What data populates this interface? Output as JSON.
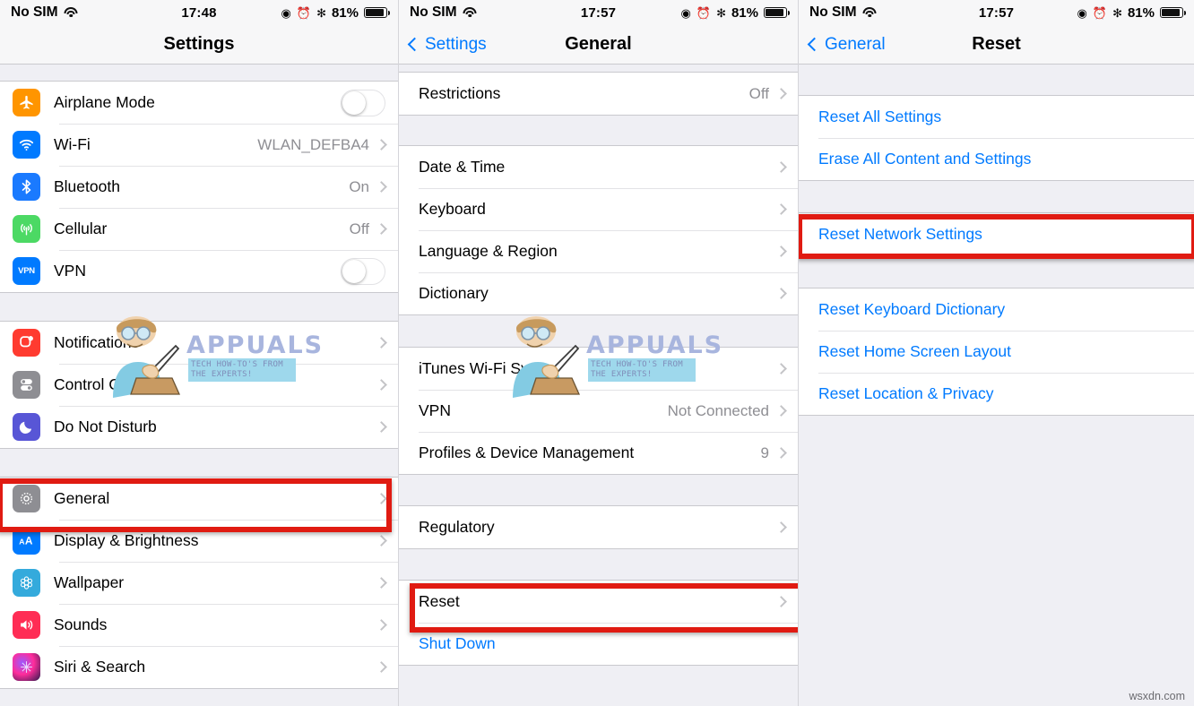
{
  "panels": [
    {
      "status": {
        "carrier": "No SIM",
        "time": "17:48",
        "battery_pct": "81%"
      },
      "nav": {
        "title": "Settings",
        "back": ""
      },
      "groups": [
        {
          "rows": [
            {
              "icon": "airplane-icon",
              "label": "Airplane Mode",
              "accessory": "toggle"
            },
            {
              "icon": "wifi-icon",
              "label": "Wi-Fi",
              "value": "WLAN_DEFBA4",
              "accessory": "chevron"
            },
            {
              "icon": "bluetooth-icon",
              "label": "Bluetooth",
              "value": "On",
              "accessory": "chevron"
            },
            {
              "icon": "cellular-icon",
              "label": "Cellular",
              "value": "Off",
              "accessory": "chevron"
            },
            {
              "icon": "vpn-icon",
              "label": "VPN",
              "accessory": "toggle"
            }
          ]
        },
        {
          "rows": [
            {
              "icon": "notifications-icon",
              "label": "Notifications",
              "accessory": "chevron"
            },
            {
              "icon": "control-center-icon",
              "label": "Control Center",
              "accessory": "chevron"
            },
            {
              "icon": "do-not-disturb-icon",
              "label": "Do Not Disturb",
              "accessory": "chevron"
            }
          ]
        },
        {
          "rows": [
            {
              "icon": "general-gear-icon",
              "label": "General",
              "accessory": "chevron",
              "highlighted": true
            },
            {
              "icon": "display-brightness-icon",
              "label": "Display & Brightness",
              "accessory": "chevron"
            },
            {
              "icon": "wallpaper-icon",
              "label": "Wallpaper",
              "accessory": "chevron"
            },
            {
              "icon": "sounds-icon",
              "label": "Sounds",
              "accessory": "chevron"
            },
            {
              "icon": "siri-search-icon",
              "label": "Siri & Search",
              "accessory": "chevron"
            }
          ]
        }
      ]
    },
    {
      "status": {
        "carrier": "No SIM",
        "time": "17:57",
        "battery_pct": "81%"
      },
      "nav": {
        "title": "General",
        "back": "Settings"
      },
      "groups": [
        {
          "rows": [
            {
              "label": "Restrictions",
              "value": "Off",
              "accessory": "chevron"
            }
          ]
        },
        {
          "rows": [
            {
              "label": "Date & Time",
              "accessory": "chevron"
            },
            {
              "label": "Keyboard",
              "accessory": "chevron"
            },
            {
              "label": "Language & Region",
              "accessory": "chevron"
            },
            {
              "label": "Dictionary",
              "accessory": "chevron"
            }
          ]
        },
        {
          "rows": [
            {
              "label": "iTunes Wi-Fi Sync",
              "accessory": "chevron"
            },
            {
              "label": "VPN",
              "value": "Not Connected",
              "accessory": "chevron"
            },
            {
              "label": "Profiles & Device Management",
              "value": "9",
              "accessory": "chevron"
            }
          ]
        },
        {
          "rows": [
            {
              "label": "Regulatory",
              "accessory": "chevron"
            }
          ]
        },
        {
          "rows": [
            {
              "label": "Reset",
              "accessory": "chevron",
              "highlighted": true
            },
            {
              "label": "Shut Down",
              "blue": true
            }
          ]
        }
      ]
    },
    {
      "status": {
        "carrier": "No SIM",
        "time": "17:57",
        "battery_pct": "81%"
      },
      "nav": {
        "title": "Reset",
        "back": "General"
      },
      "groups": [
        {
          "rows": [
            {
              "label": "Reset All Settings",
              "blue": true
            },
            {
              "label": "Erase All Content and Settings",
              "blue": true
            }
          ]
        },
        {
          "rows": [
            {
              "label": "Reset Network Settings",
              "blue": true,
              "highlighted": true
            }
          ]
        },
        {
          "rows": [
            {
              "label": "Reset Keyboard Dictionary",
              "blue": true
            },
            {
              "label": "Reset Home Screen Layout",
              "blue": true
            },
            {
              "label": "Reset Location & Privacy",
              "blue": true
            }
          ]
        }
      ]
    }
  ],
  "watermark": {
    "brand": "APPUALS",
    "tagline_1": "TECH HOW-TO'S FROM",
    "tagline_2": "THE EXPERTS!"
  },
  "footer_watermark": "wsxdn.com",
  "colors": {
    "accent": "#007aff",
    "highlight": "#e01b12",
    "separator": "#c9c9ce",
    "group_bg": "#efeff4"
  },
  "icons": {
    "vpn_text": "VPN",
    "display_text": "AA"
  },
  "labels": {
    "status_icons": [
      "location-icon",
      "alarm-icon",
      "bluetooth-icon",
      "battery-icon"
    ]
  }
}
